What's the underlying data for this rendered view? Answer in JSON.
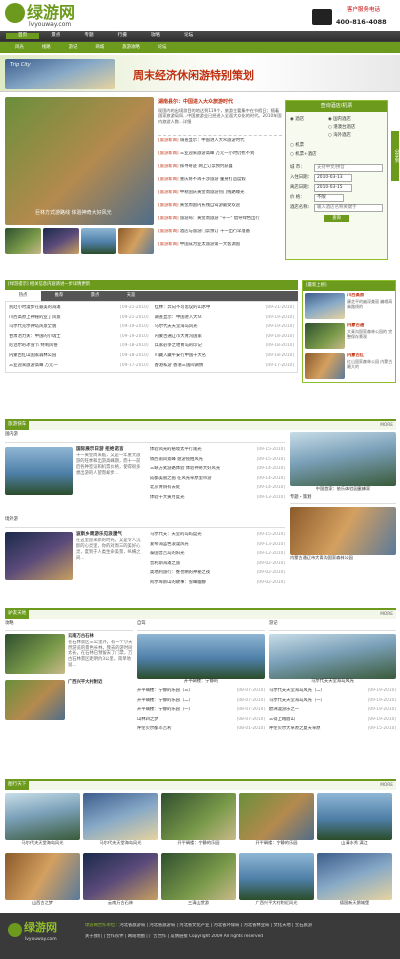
{
  "brand": {
    "logo": "绿游网",
    "domain": "lvyouway.com",
    "hotline_label": "客户服务电话",
    "hotline": "400-816-4088"
  },
  "nav": [
    "首页",
    "景点",
    "专题",
    "行摄",
    "攻略",
    "论坛",
    "风光",
    "线路",
    "游记",
    "商城",
    "旅游攻略",
    "论坛"
  ],
  "banner": {
    "logo": "Trip City",
    "title": "周末经济休闲游特别策划"
  },
  "focus": {
    "caption": "巨林方式游路线 体验神奇大好风光"
  },
  "headline": {
    "title": "湖南县尔：中国进入大众旅游时代",
    "body": "现国内的出境游目的地达到119个，旅游主要集中在节假日；随着国家旅游局同...中国旅游业已经进入全面大众化的时代。2010年国内旅游人数...详细"
  },
  "news": [
    {
      "tag": "[旅游新闻]",
      "t": "调查显示：中国进入大众旅游时代"
    },
    {
      "tag": "[旅游新闻]",
      "t": "三亚迎来旅游高峰 万元一小时仍抢不到"
    },
    {
      "tag": "[旅游新闻]",
      "t": "探寻奇迹 网上订票预约获喜"
    },
    {
      "tag": "[旅游新闻]",
      "t": "重庆将不再干涉旅游 量身打造度假"
    },
    {
      "tag": "[旅游新闻]",
      "t": "中秋国庆黄金周旅游热门线路曝光"
    },
    {
      "tag": "[旅游新闻]",
      "t": "黄金周国内长线自驾游最受欢迎"
    },
    {
      "tag": "[旅游新闻]",
      "t": "旅游局：黄金周旅游 \"十一\" 倡导绿色出行"
    },
    {
      "tag": "[旅游新闻]",
      "t": "酒店与旅游门票预订 十一出行早准备"
    },
    {
      "tag": "[旅游新闻]",
      "t": "中国成为亚太旅游第一大客源国"
    }
  ],
  "hotel": {
    "title": "查询酒店/机票",
    "opt_hotel": "酒店",
    "opt_domestic": "国内酒店",
    "opt_hk": "港澳台酒店",
    "opt_intl": "海外酒店",
    "opt_flight": "机票",
    "opt_both": "机票+酒店",
    "city_label": "城  市：",
    "city_value": "支持中文/拼音",
    "checkin_label": "入住日期：",
    "checkin": "2010-03-13",
    "checkout_label": "离店日期：",
    "checkout": "2010-03-15",
    "price_label": "价  格：",
    "price": "不限",
    "name_label": "酒店名称：",
    "name_placeholder": "输入酒店名称关键字",
    "submit": "查询",
    "side": "分享到"
  },
  "mid": {
    "tip": "[绿游提示] 相关信息内容请进一步详情更新",
    "tabs": [
      "热点",
      "推荐",
      "景点",
      "天涯"
    ],
    "left": [
      {
        "t": "别赴小时漫步在最美的海滩",
        "d": "[09-21-2010]"
      },
      {
        "t": "川西高原上神秘的亚丁风景",
        "d": "[09-21-2010]"
      },
      {
        "t": "乌尔代克尔钟塔风景全貌",
        "d": "[09-19-2010]"
      },
      {
        "t": "甘肃冶力关：中国的小瑞士",
        "d": "[09-19-2010]"
      },
      {
        "t": "尼泊尔的冰雪节 特制风俗",
        "d": "[09-18-2010]"
      },
      {
        "t": "内蒙古红山国家森林公园",
        "d": "[09-18-2010]"
      },
      {
        "t": "三亚迎来旅游高峰 万元一",
        "d": "[09-17-2010]"
      }
    ],
    "right": [
      {
        "t": "桂林：奔向不可思议的山水中",
        "d": "[09-21-2010]"
      },
      {
        "t": "调查显示：中国进入大众",
        "d": "[09-19-2010]"
      },
      {
        "t": "马尔代夫天堂海岛风光",
        "d": "[09-19-2010]"
      },
      {
        "t": "内蒙古通辽市大青沟国家",
        "d": "[09-18-2010]"
      },
      {
        "t": "兵家必争之地青岛的印记",
        "d": "[09-18-2010]"
      },
      {
        "t": "川藏入藏平安行中国十大名",
        "d": "[09-18-2010]"
      },
      {
        "t": "香港私游 香港三国间调情",
        "d": "[09-17-2010]"
      }
    ]
  },
  "rank": {
    "title": "[最新上榜]",
    "items": [
      {
        "t": "川西高原",
        "d": "康芝平的幽深美丽 巍峨高耸路线的"
      },
      {
        "t": "内蒙古通",
        "d": "大青沟国家森林公园的 完整保存景观"
      },
      {
        "t": "内蒙古红",
        "d": "红山国家森林公园 内蒙古最大的"
      }
    ]
  },
  "trip": {
    "title": "旅游快车",
    "more": "MORE",
    "domestic": {
      "label": "国内游",
      "feature": "国际展示日游 拒绝诺言",
      "body": "十一黄金周来临，又是一年重大旅游的旺季和出游高峰期，而十一前后各种签证和机票价格，使得很多想出游的人望而却步...",
      "list": [
        {
          "t": "体验风光的秘境太平行观光",
          "d": "[09-15-2010]"
        },
        {
          "t": "佩西南风景峰 盘游揽拍风光",
          "d": "[09-15-2010]"
        },
        {
          "t": "三峡方式游路体验 体验神奇大好风光",
          "d": "[09-14-2010]"
        },
        {
          "t": "成都美丽之画 在风光草原里带游",
          "d": "[09-14-2010]"
        },
        {
          "t": "北京青铜有去处",
          "d": "[09-14-2010]"
        },
        {
          "t": "体验十大黄月度光",
          "d": "[09-13-2010]"
        }
      ]
    },
    "abroad": {
      "label": "境外游",
      "feature": "波斯乡周游乐见浪漫气",
      "body": "在这里迎来新的时光，又是令人沉醉的心灵里，你的对周三的美好心灵，度到于人类生命美景，纵横之间...",
      "list": [
        {
          "t": "马尔代夫：天堂的岛屿度光",
          "d": "[09-15-2010]"
        },
        {
          "t": "爱琴海蓝色浪漫风光",
          "d": "[09-13-2010]"
        },
        {
          "t": "泰国普吉岛的阳光",
          "d": "[09-12-2010]"
        },
        {
          "t": "普利斯海滩之旅",
          "d": "[09-02-2010]"
        },
        {
          "t": "奥地利旅行：维也纳的神秘之夜",
          "d": "[09-02-2010]"
        },
        {
          "t": "阿尔卑斯山的故事：雪峰幽静",
          "d": "[09-02-2010]"
        }
      ]
    },
    "photos": [
      {
        "cap": "中国首家：依乐体验园蜜蜂家"
      },
      {
        "cap": "川西高原上神秘的亚丁风景"
      },
      {
        "cap": "内蒙古通辽市大青沟国家森林公园"
      }
    ],
    "topic_label": "专题・策划"
  },
  "guide": {
    "title": "驴友天地",
    "cols": [
      {
        "label": "攻略",
        "feature": "云南万古石林",
        "body": "苍石林景区三公里外，有一个小天然游览的景色长林，我去的游时间太长，在石林已预留去了门票，万古石林景区距明约3公里，简单地说...",
        "feature2": "广西兴平大村附近",
        "list": []
      },
      {
        "label": "自驾",
        "photo": "开平碉楼：宁静的",
        "list": [
          {
            "t": "开平碉楼：宁静的乐园（三）",
            "d": "[08-07-2010]"
          },
          {
            "t": "开平碉楼：宁静的乐园（二）",
            "d": "[08-07-2010]"
          },
          {
            "t": "开平碉楼：宁静的乐园（一）",
            "d": "[08-07-2010]"
          },
          {
            "t": "山林四之梦",
            "d": "[08-07-2010]"
          },
          {
            "t": "呼伦贝尔都市吉利",
            "d": "[08-01-2010]"
          }
        ]
      },
      {
        "label": "游记",
        "photo": "马尔代夫天堂海岛风光",
        "list": [
          {
            "t": "马尔代夫天堂海岛风光（二）",
            "d": "[09-19-2010]"
          },
          {
            "t": "马尔代夫天堂海岛风光（一）",
            "d": "[09-19-2010]"
          },
          {
            "t": "欧洲漫游乐之一",
            "d": "[09-19-2010]"
          },
          {
            "t": "三得上峨眉山",
            "d": "[09-19-2010]"
          },
          {
            "t": "呼伦贝尔大草原之夏天草原",
            "d": "[09-15-2010]"
          }
        ]
      }
    ]
  },
  "gallery": {
    "title": "图行天下",
    "items": [
      "马尔代夫天堂海岛风光",
      "马尔代夫天堂海岛风光",
      "开平碉楼：宁静的乐园",
      "开平碉楼：宁静的乐园",
      "山清水秀 漓江",
      "山西古之梦",
      "云南万古石林",
      "三清山赏游",
      "广西兴平大村附近风光",
      "德国新天鹅城堡"
    ]
  },
  "footer": {
    "logo": "绿游网",
    "domain": "lvyouway.com",
    "links_label": "绿游网合作单位：",
    "links": "河北省旅游局 | 河北省旅游局 | 河北省文化产业 | 河北省环保局 | 河北省林业局 | 文化天地 | 宝石旅游",
    "row2": "关于我们 | 合作伙伴 | 网站地图 | 广告合作 | 友情链接",
    "copyright": "Copyright 2009 All rights reserved"
  }
}
